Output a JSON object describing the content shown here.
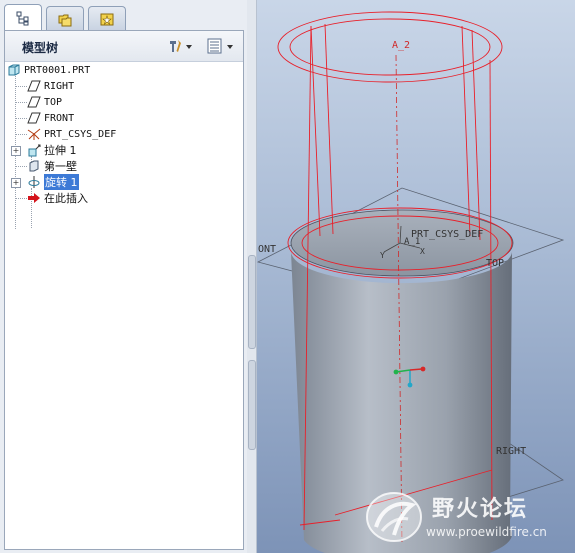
{
  "tabs": [
    {
      "icon": "model-tree-icon",
      "active": true
    },
    {
      "icon": "folder-browser-icon",
      "active": false
    },
    {
      "icon": "favorites-icon",
      "active": false
    }
  ],
  "tree_panel": {
    "title": "模型树",
    "tools": [
      {
        "icon": "tree-settings-icon"
      },
      {
        "icon": "tree-columns-icon"
      }
    ]
  },
  "tree_items": [
    {
      "label": "PRT0001.PRT",
      "icon": "part-icon"
    },
    {
      "label": "RIGHT",
      "icon": "datum-plane-icon"
    },
    {
      "label": "TOP",
      "icon": "datum-plane-icon"
    },
    {
      "label": "FRONT",
      "icon": "datum-plane-icon"
    },
    {
      "label": "PRT_CSYS_DEF",
      "icon": "csys-icon"
    },
    {
      "label": "拉伸 1",
      "icon": "extrude-icon"
    },
    {
      "label": "第一壁",
      "icon": "wall-icon"
    },
    {
      "label": "旋转 1",
      "icon": "revolve-icon",
      "selected": true
    },
    {
      "label": "在此插入",
      "icon": "insert-here-icon"
    }
  ],
  "viewport": {
    "labels": {
      "axis": "A_2",
      "axis_small": "A_1",
      "csys": "PRT_CSYS_DEF",
      "front_plane": "ONT",
      "top_plane": "TOP",
      "right_plane": "RIGHT",
      "csys_y": "Y",
      "csys_x": "X"
    },
    "colors": {
      "background_top": "#c9d6e8",
      "background_bottom": "#7d93b7",
      "highlight": "#e8202a",
      "body": "#9aa3af"
    }
  },
  "watermark": {
    "title": "野火论坛",
    "url": "www.proewildfire.cn"
  }
}
